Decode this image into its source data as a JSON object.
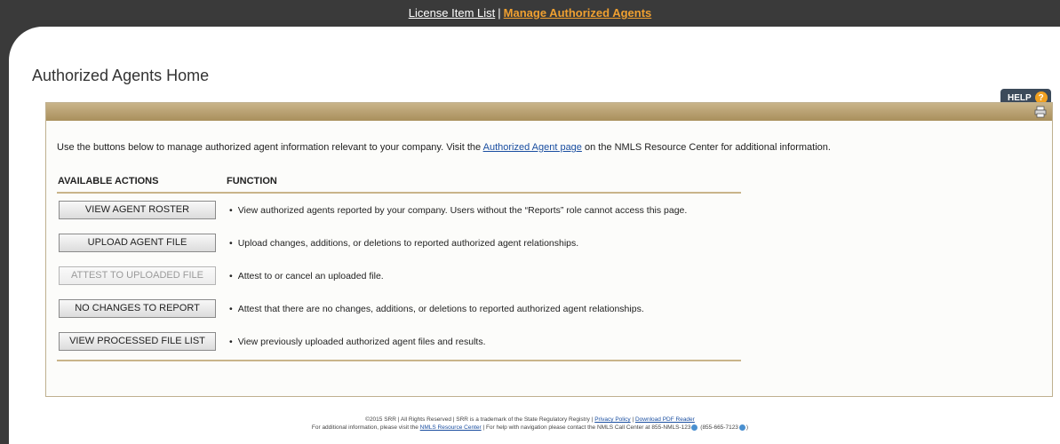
{
  "nav": {
    "license_item_list": "License Item List",
    "separator": "|",
    "manage_authorized_agents": "Manage Authorized Agents"
  },
  "page": {
    "title": "Authorized Agents Home",
    "help_label": "HELP",
    "help_icon": "?"
  },
  "intro": {
    "before_link": "Use the buttons below to manage authorized agent information relevant to your company. Visit the ",
    "link_text": "Authorized Agent page",
    "after_link": " on the NMLS Resource Center for additional information."
  },
  "table": {
    "col_actions": "AVAILABLE ACTIONS",
    "col_function": "FUNCTION",
    "rows": [
      {
        "button": "VIEW AGENT ROSTER",
        "function": "View authorized agents reported by your company. Users without the “Reports” role cannot access this page.",
        "enabled": true
      },
      {
        "button": "UPLOAD AGENT FILE",
        "function": "Upload changes, additions, or deletions to reported authorized agent relationships.",
        "enabled": true
      },
      {
        "button": "ATTEST TO UPLOADED FILE",
        "function": "Attest to or cancel an uploaded file.",
        "enabled": false
      },
      {
        "button": "NO CHANGES TO REPORT",
        "function": "Attest that there are no changes, additions, or deletions to reported authorized agent relationships.",
        "enabled": true
      },
      {
        "button": "VIEW PROCESSED FILE LIST",
        "function": "View previously uploaded authorized agent files and results.",
        "enabled": true
      }
    ]
  },
  "footer": {
    "line1_text": "©2015 SRR | All Rights Reserved | SRR is a trademark of the State Regulatory Registry | ",
    "privacy_policy": "Privacy Policy",
    "sep": " | ",
    "download_pdf": "Download PDF Reader",
    "line2_before": "For additional information, please visit the ",
    "resource_center": "NMLS Resource Center",
    "line2_after": " | For help with navigation please contact the NMLS Call Center at 855-NMLS-123",
    "phone_numeric": " (855-665-7123",
    "phone_close": ")"
  },
  "colors": {
    "accent": "#f0a030",
    "header_band": "#b09b6c",
    "link": "#1a4ea0"
  },
  "icons": {
    "print": "print-icon",
    "help": "help-icon",
    "phone": "phone-icon"
  }
}
